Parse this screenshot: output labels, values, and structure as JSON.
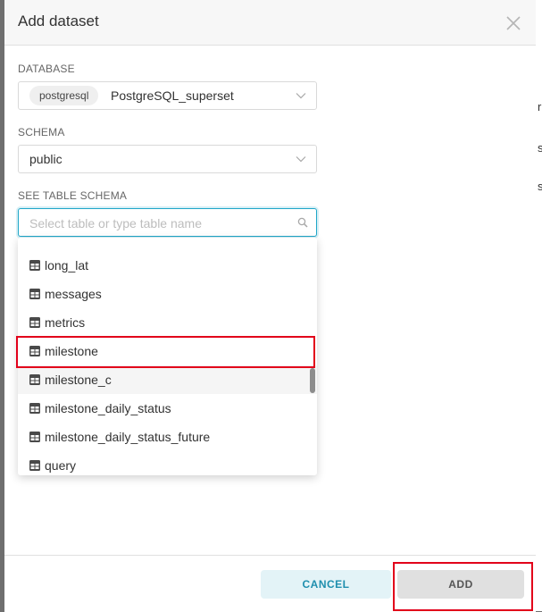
{
  "modal": {
    "title": "Add dataset"
  },
  "database": {
    "label": "DATABASE",
    "tag": "postgresql",
    "value": "PostgreSQL_superset"
  },
  "schema": {
    "label": "SCHEMA",
    "value": "public"
  },
  "table": {
    "label": "SEE TABLE SCHEMA",
    "placeholder": "Select table or type table name"
  },
  "options": [
    {
      "label": "long_lat"
    },
    {
      "label": "messages"
    },
    {
      "label": "metrics"
    },
    {
      "label": "milestone"
    },
    {
      "label": "milestone_c"
    },
    {
      "label": "milestone_daily_status"
    },
    {
      "label": "milestone_daily_status_future"
    },
    {
      "label": "query"
    }
  ],
  "footer": {
    "cancel_label": "CANCEL",
    "add_label": "ADD"
  },
  "colors": {
    "accent": "#20a7c9",
    "highlight": "#e2001a"
  }
}
